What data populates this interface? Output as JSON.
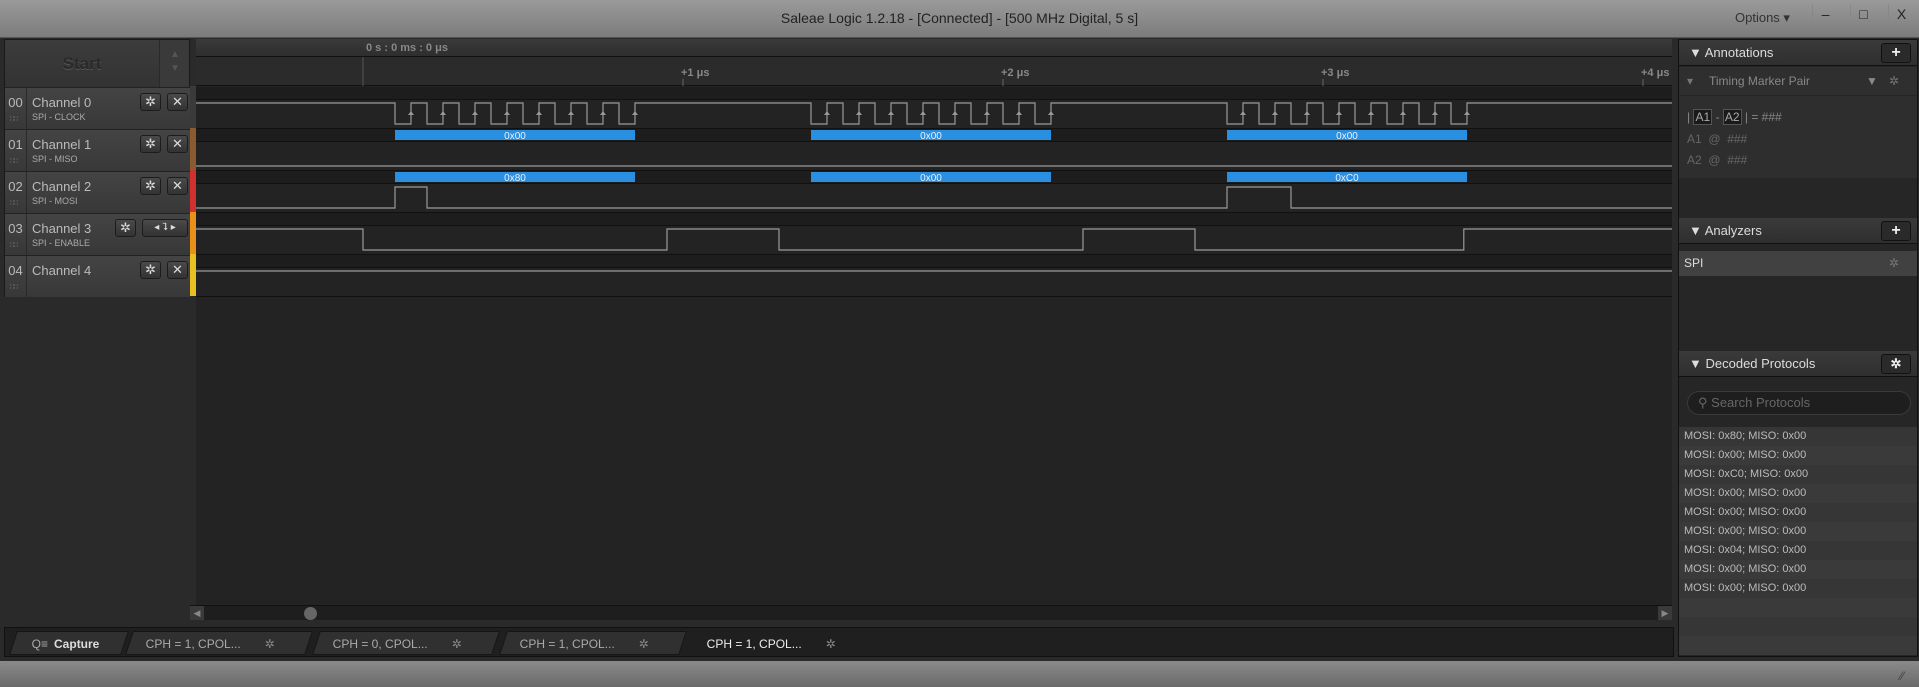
{
  "window": {
    "title": "Saleae Logic 1.2.18 - [Connected] - [500 MHz Digital, 5 s]",
    "options_label": "Options ▾",
    "minimize": "–",
    "maximize": "□",
    "close": "X"
  },
  "start_label": "Start",
  "timeline": {
    "origin_label": "0 s : 0 ms : 0 μs",
    "ticks": [
      "+1 μs",
      "+2 μs",
      "+3 μs",
      "+4 μs"
    ]
  },
  "channels": [
    {
      "num": "00",
      "name": "Channel 0",
      "sub": "SPI - CLOCK",
      "color": "#3a3a3a"
    },
    {
      "num": "01",
      "name": "Channel 1",
      "sub": "SPI - MISO",
      "color": "#8a5a30"
    },
    {
      "num": "02",
      "name": "Channel 2",
      "sub": "SPI - MOSI",
      "color": "#d03030"
    },
    {
      "num": "03",
      "name": "Channel 3",
      "sub": "SPI - ENABLE",
      "color": "#e8901a"
    },
    {
      "num": "04",
      "name": "Channel 4",
      "sub": "",
      "color": "#e8c020"
    }
  ],
  "signals": {
    "time_unit": "us",
    "range": [
      -0.5,
      4.0
    ],
    "ch0": {
      "idle": 1,
      "lows": [
        [
          0.1,
          0.15
        ],
        [
          0.2,
          0.25
        ],
        [
          0.3,
          0.35
        ],
        [
          0.4,
          0.45
        ],
        [
          0.5,
          0.55
        ],
        [
          0.6,
          0.65
        ],
        [
          0.7,
          0.75
        ],
        [
          0.8,
          0.85
        ],
        [
          1.4,
          1.45
        ],
        [
          1.5,
          1.55
        ],
        [
          1.6,
          1.65
        ],
        [
          1.7,
          1.75
        ],
        [
          1.8,
          1.85
        ],
        [
          1.9,
          1.95
        ],
        [
          2.0,
          2.05
        ],
        [
          2.1,
          2.15
        ],
        [
          2.7,
          2.75
        ],
        [
          2.8,
          2.85
        ],
        [
          2.9,
          2.95
        ],
        [
          3.0,
          3.05
        ],
        [
          3.1,
          3.15
        ],
        [
          3.2,
          3.25
        ],
        [
          3.3,
          3.35
        ],
        [
          3.4,
          3.45
        ]
      ]
    },
    "ch1": {
      "idle": 0,
      "highs": []
    },
    "ch2": {
      "idle": 0,
      "highs": [
        [
          0.1,
          0.2
        ],
        [
          2.7,
          2.9
        ]
      ]
    },
    "ch3": {
      "idle": 1,
      "lows": [
        [
          0,
          0.95
        ],
        [
          1.3,
          2.25
        ],
        [
          2.6,
          3.44
        ]
      ]
    },
    "ch4": {
      "idle": 1,
      "lows": []
    }
  },
  "decoded": {
    "miso": [
      {
        "t": [
          0.1,
          0.85
        ],
        "label": "0x00"
      },
      {
        "t": [
          1.4,
          2.15
        ],
        "label": "0x00"
      },
      {
        "t": [
          2.7,
          3.45
        ],
        "label": "0x00"
      }
    ],
    "mosi": [
      {
        "t": [
          0.1,
          0.85
        ],
        "label": "0x80"
      },
      {
        "t": [
          1.4,
          2.15
        ],
        "label": "0x00"
      },
      {
        "t": [
          2.7,
          3.45
        ],
        "label": "0xC0"
      }
    ],
    "bar_color": "#2a8fe0"
  },
  "tabs": [
    {
      "label": "Capture"
    },
    {
      "label": "CPH = 1, CPOL..."
    },
    {
      "label": "CPH = 0, CPOL..."
    },
    {
      "label": "CPH = 1, CPOL..."
    },
    {
      "label": "CPH = 1, CPOL..."
    }
  ],
  "annotations": {
    "title": "Annotations",
    "marker": "Timing Marker Pair",
    "formula": [
      "|",
      "A1",
      "-",
      "A2",
      "| = ###"
    ],
    "a1": "A1  @  ###",
    "a2": "A2  @  ###"
  },
  "analyzers": {
    "title": "Analyzers",
    "items": [
      "SPI"
    ]
  },
  "decoded_protocols": {
    "title": "Decoded Protocols",
    "search_placeholder": "Search Protocols",
    "rows": [
      "MOSI: 0x80;  MISO: 0x00",
      "MOSI: 0x00;  MISO: 0x00",
      "MOSI: 0xC0;  MISO: 0x00",
      "MOSI: 0x00;  MISO: 0x00",
      "MOSI: 0x00;  MISO: 0x00",
      "MOSI: 0x00;  MISO: 0x00",
      "MOSI: 0x04;  MISO: 0x00",
      "MOSI: 0x00;  MISO: 0x00",
      "MOSI: 0x00;  MISO: 0x00"
    ]
  }
}
